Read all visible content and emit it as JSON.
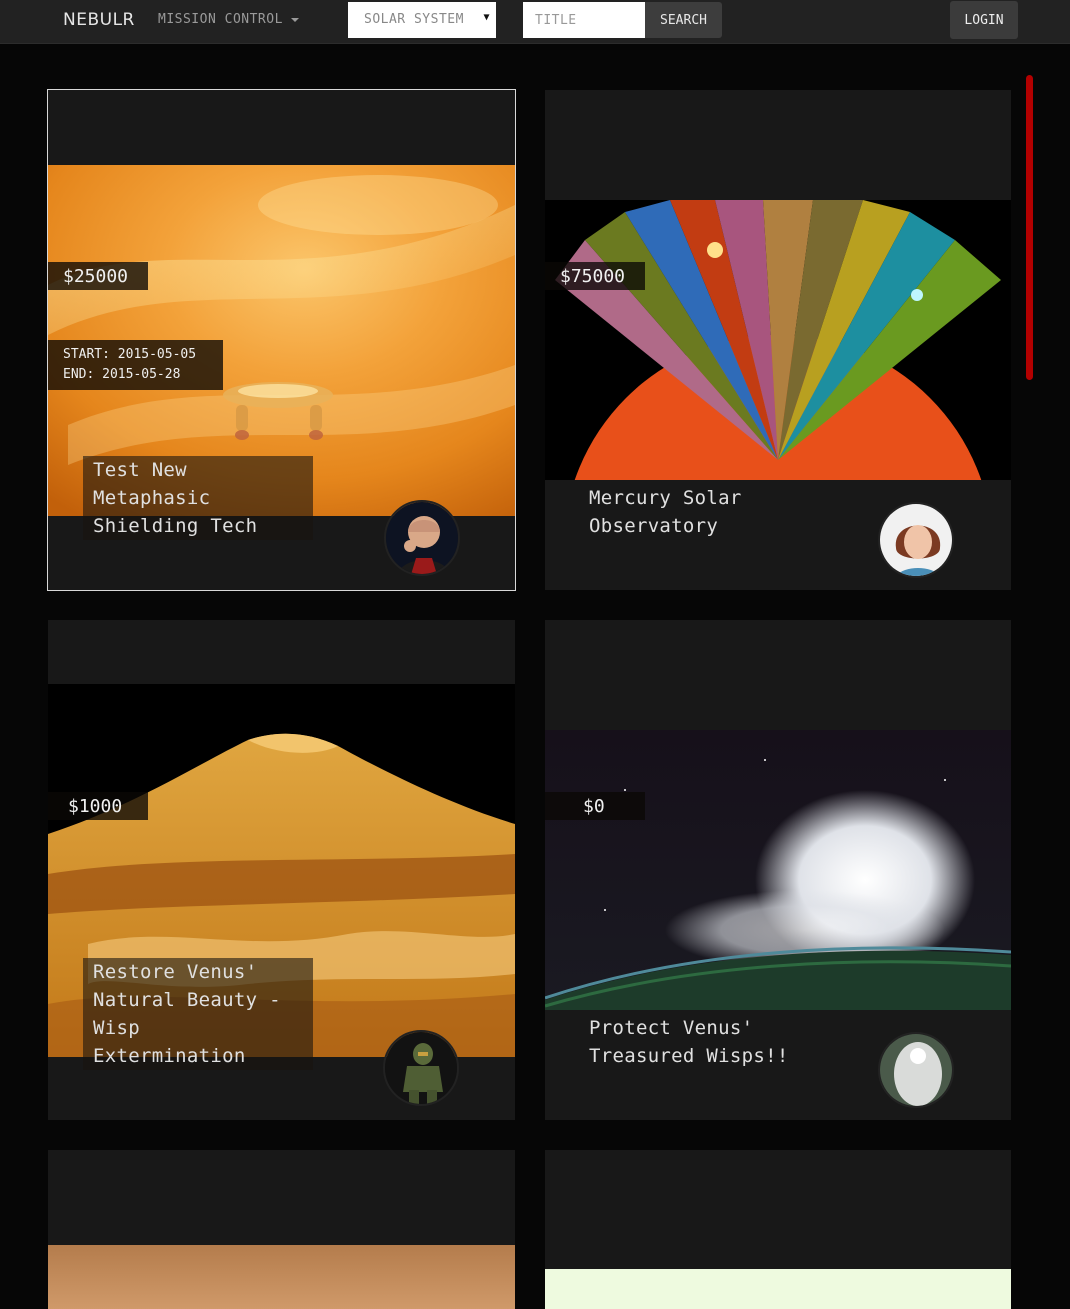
{
  "nav": {
    "brand": "NEBULR",
    "menu_label": "MISSION CONTROL",
    "select_value": "SOLAR SYSTEM",
    "search_placeholder": "TITLE",
    "search_label": "SEARCH",
    "login_label": "LOGIN"
  },
  "cards": [
    {
      "price": "$25000",
      "start": "START: 2015-05-05",
      "end": "END: 2015-05-28",
      "title": "Test New Metaphasic Shielding Tech",
      "avatar": "captain-avatar"
    },
    {
      "price": "$75000",
      "title": "Mercury Solar Observatory",
      "avatar": "woman-avatar"
    },
    {
      "price": "$1000",
      "title": "Restore Venus' Natural Beauty - Wisp Extermination",
      "avatar": "armored-soldier-avatar"
    },
    {
      "price": "$0",
      "title": "Protect Venus' Treasured Wisps!!",
      "avatar": "white-figure-avatar"
    }
  ],
  "colors": {
    "accent": "#b30000",
    "card_bg": "#181818",
    "page_bg": "#060606",
    "navbar_bg": "#222222"
  }
}
